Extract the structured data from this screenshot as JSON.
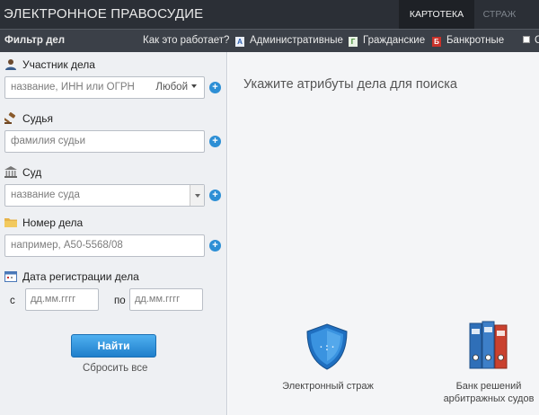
{
  "header": {
    "brand": "ЭЛЕКТРОННОЕ ПРАВОСУДИЕ",
    "tabs": [
      {
        "label": "КАРТОТЕКА",
        "active": true
      },
      {
        "label": "СТРАЖ",
        "active": false
      }
    ]
  },
  "filterbar": {
    "title": "Фильтр дел",
    "how": "Как это работает?",
    "categories": [
      {
        "badge": "А",
        "label": "Административные"
      },
      {
        "badge": "Г",
        "label": "Гражданские"
      },
      {
        "badge": "Б",
        "label": "Банкротные"
      }
    ],
    "extra_checkbox_label": "С"
  },
  "form": {
    "participant": {
      "label": "Участник дела",
      "placeholder": "название, ИНН или ОГРН",
      "role": "Любой"
    },
    "judge": {
      "label": "Судья",
      "placeholder": "фамилия судьи"
    },
    "court": {
      "label": "Суд",
      "placeholder": "название суда"
    },
    "case_number": {
      "label": "Номер дела",
      "placeholder": "например, А50-5568/08"
    },
    "reg_date": {
      "label": "Дата регистрации дела",
      "from_label": "с",
      "to_label": "по",
      "from_placeholder": "дд.мм.гггг",
      "to_placeholder": "дд.мм.гггг"
    },
    "find_button": "Найти",
    "reset_link": "Сбросить все"
  },
  "main": {
    "hint": "Укажите атрибуты дела для поиска",
    "tiles": [
      {
        "label": "Электронный страж"
      },
      {
        "label_line1": "Банк решений",
        "label_line2": "арбитражных судов"
      }
    ]
  },
  "colors": {
    "topbar": "#2b2f36",
    "filterbar": "#3b4048",
    "accent": "#2d8fd5",
    "left_panel": "#eef0f3"
  }
}
